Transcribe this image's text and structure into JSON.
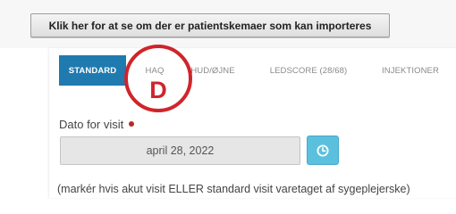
{
  "import_button": {
    "label": "Klik her for at se om der er patientskemaer som kan importeres"
  },
  "tabs": [
    {
      "label": "STANDARD",
      "active": true
    },
    {
      "label": "HAQ",
      "active": false
    },
    {
      "label": "HUD/ØJNE",
      "active": false
    },
    {
      "label": "LEDSCORE (28/68)",
      "active": false
    },
    {
      "label": "INJEKTIONER",
      "active": false
    }
  ],
  "annotation": {
    "label": "D",
    "color": "#d0242b"
  },
  "visit_date": {
    "label": "Dato for visit",
    "value": "april 28, 2022",
    "required": true,
    "time_icon": "clock-icon"
  },
  "note": "(markér hvis akut visit ELLER standard visit varetaget af sygeplejerske)",
  "colors": {
    "active_tab": "#1f7ab0",
    "annotation": "#d0242b",
    "time_button": "#5bc0de",
    "required_dot": "#b52a2a"
  }
}
